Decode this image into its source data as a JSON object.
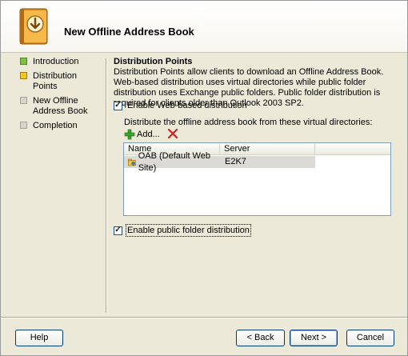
{
  "wizard": {
    "title": "New Offline Address Book"
  },
  "nav": {
    "items": [
      {
        "label": "Introduction",
        "state": "done"
      },
      {
        "label": "Distribution Points",
        "state": "current"
      },
      {
        "label": "New Offline Address Book",
        "state": "pending"
      },
      {
        "label": "Completion",
        "state": "pending"
      }
    ]
  },
  "content": {
    "section_title": "Distribution Points",
    "description": "Distribution Points allow clients to download an Offline Address Book. Web-based distribution uses virtual directories while public folder distribution uses Exchange public folders. Public folder distribution is required for clients older than Outlook 2003 SP2.",
    "web_checkbox": {
      "label": "Enable Web-based distribution",
      "checked": true
    },
    "vdir_label": "Distribute the offline address book from these virtual directories:",
    "toolbar": {
      "add_label": "Add..."
    },
    "table": {
      "columns": [
        "Name",
        "Server"
      ],
      "rows": [
        {
          "name": "OAB (Default Web Site)",
          "server": "E2K7"
        }
      ]
    },
    "public_checkbox": {
      "label": "Enable public folder distribution",
      "checked": true
    }
  },
  "buttons": {
    "help": "Help",
    "back": "< Back",
    "next": "Next >",
    "cancel": "Cancel"
  },
  "colors": {
    "done": "#7fc241",
    "current": "#f3c51f",
    "pending": "#d6d3ca"
  }
}
